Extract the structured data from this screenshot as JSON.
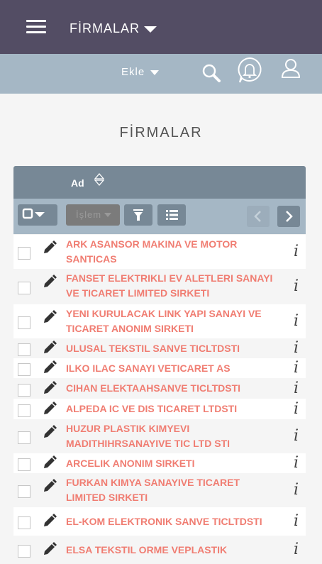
{
  "header": {
    "module_title": "FİRMALAR"
  },
  "actions": {
    "ekle_label": "Ekle"
  },
  "page": {
    "heading": "FİRMALAR"
  },
  "list": {
    "column_name": "Ad",
    "bulk_action_label": "İşlem",
    "rows": [
      {
        "name": "ARK ASANSOR MAKINA VE MOTOR SANTICAS"
      },
      {
        "name": "FANSET ELEKTRIKLI EV ALETLERI SANAYI VE TICARET LIMITED SIRKETI"
      },
      {
        "name": "YENI KURULACAK LINK YAPI SANAYI VE TICARET ANONIM SIRKETI"
      },
      {
        "name": "ULUSAL TEKSTIL SANVE TICLTDSTI"
      },
      {
        "name": "ILKO ILAC SANAYI VETICARET AS"
      },
      {
        "name": "CIHAN ELEKTAAHSANVE TICLTDSTI"
      },
      {
        "name": "ALPEDA IC VE DIS TICARET LTDSTI"
      },
      {
        "name": "HUZUR PLASTIK KIMYEVI MADITHIHRSANAYIVE TIC LTD STI"
      },
      {
        "name": "ARCELIK ANONIM SIRKETI"
      },
      {
        "name": "FURKAN KIMYA SANAYIVE TICARET LIMITED SIRKETI"
      },
      {
        "name": "EL-KOM ELEKTRONIK SANVE TICLTDSTI"
      },
      {
        "name": "ELSA TEKSTIL ORME VEPLASTIK"
      }
    ]
  }
}
